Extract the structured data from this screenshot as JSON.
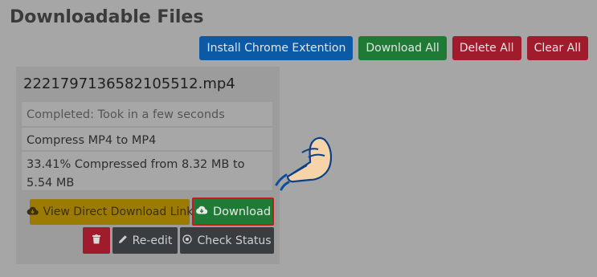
{
  "page": {
    "title": "Downloadable Files"
  },
  "top_actions": {
    "install_label": "Install Chrome Extention",
    "download_all_label": "Download All",
    "delete_all_label": "Delete All",
    "clear_all_label": "Clear All"
  },
  "file": {
    "name": "2221797136582105512.mp4",
    "status": "Completed: Took in a few seconds",
    "operation": "Compress MP4 to MP4",
    "result": "33.41% Compressed from 8.32 MB to 5.54 MB"
  },
  "actions": {
    "view_link_label": "View Direct Download Link",
    "download_label": "Download",
    "reedit_label": "Re-edit",
    "check_status_label": "Check Status"
  },
  "icons": {
    "view_link": "cloud-download-icon",
    "download": "cloud-download-icon",
    "delete": "trash-icon",
    "reedit": "pencil-icon",
    "check_status": "circle-dot-icon",
    "pointer": "pointing-hand-icon"
  },
  "colors": {
    "primary": "#0c5aa6",
    "success": "#1e7a34",
    "danger": "#a01c2c",
    "warning": "#9c7b05",
    "dark": "#3a3d40",
    "highlight_border": "#c61a1a"
  }
}
